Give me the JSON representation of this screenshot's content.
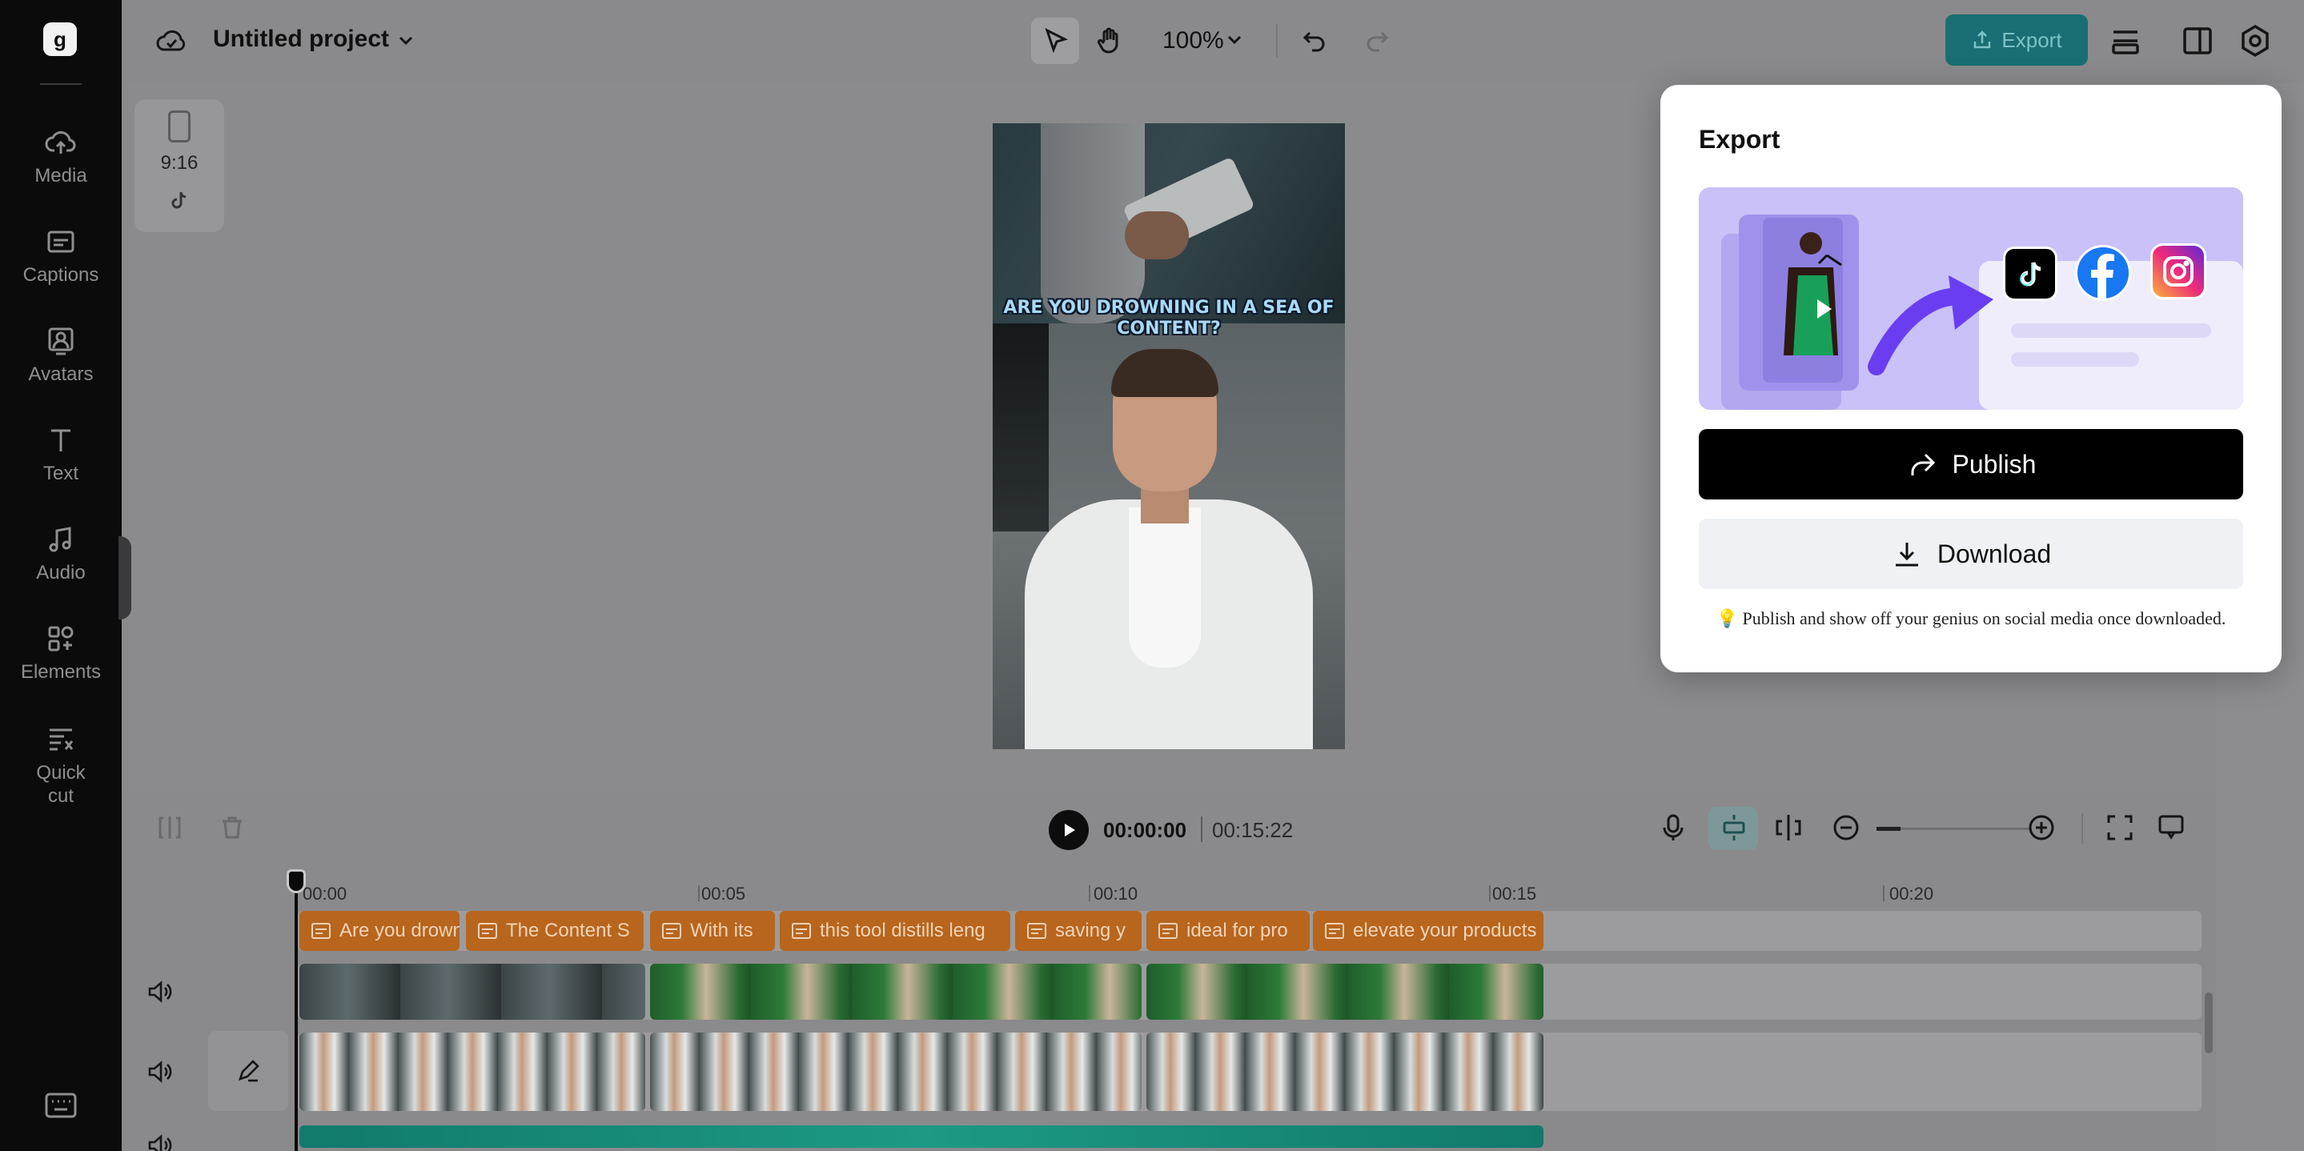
{
  "app": {
    "project_title": "Untitled project",
    "zoom": "100%"
  },
  "sidebar": {
    "items": [
      {
        "label": "Media",
        "icon": "cloud-upload-icon"
      },
      {
        "label": "Captions",
        "icon": "captions-icon"
      },
      {
        "label": "Avatars",
        "icon": "avatar-icon"
      },
      {
        "label": "Text",
        "icon": "text-icon"
      },
      {
        "label": "Audio",
        "icon": "music-note-icon"
      },
      {
        "label": "Elements",
        "icon": "elements-icon"
      },
      {
        "label": "Quick cut",
        "icon": "quick-cut-icon"
      }
    ]
  },
  "toolbar": {
    "export_label": "Export",
    "accent_color": "#1a6e73"
  },
  "canvas": {
    "aspect_ratio": "9:16",
    "video_caption": "ARE YOU DROWNING IN A SEA OF CONTENT?"
  },
  "timeline": {
    "current_time": "00:00:00",
    "total_time": "00:15:22",
    "ruler": [
      "00:00",
      "00:05",
      "00:10",
      "00:15",
      "00:20"
    ],
    "captions": [
      "Are you drowning in a sea",
      "The Content S",
      "With its",
      "this tool distills leng",
      "saving y",
      "ideal for pro",
      "elevate your products"
    ],
    "caption_color": "#b8651e"
  },
  "export_panel": {
    "title": "Export",
    "publish_label": "Publish",
    "download_label": "Download",
    "hint": "💡 Publish and show off your genius on social media once downloaded.",
    "social_icons": [
      "tiktok-icon",
      "facebook-icon",
      "instagram-icon"
    ]
  }
}
